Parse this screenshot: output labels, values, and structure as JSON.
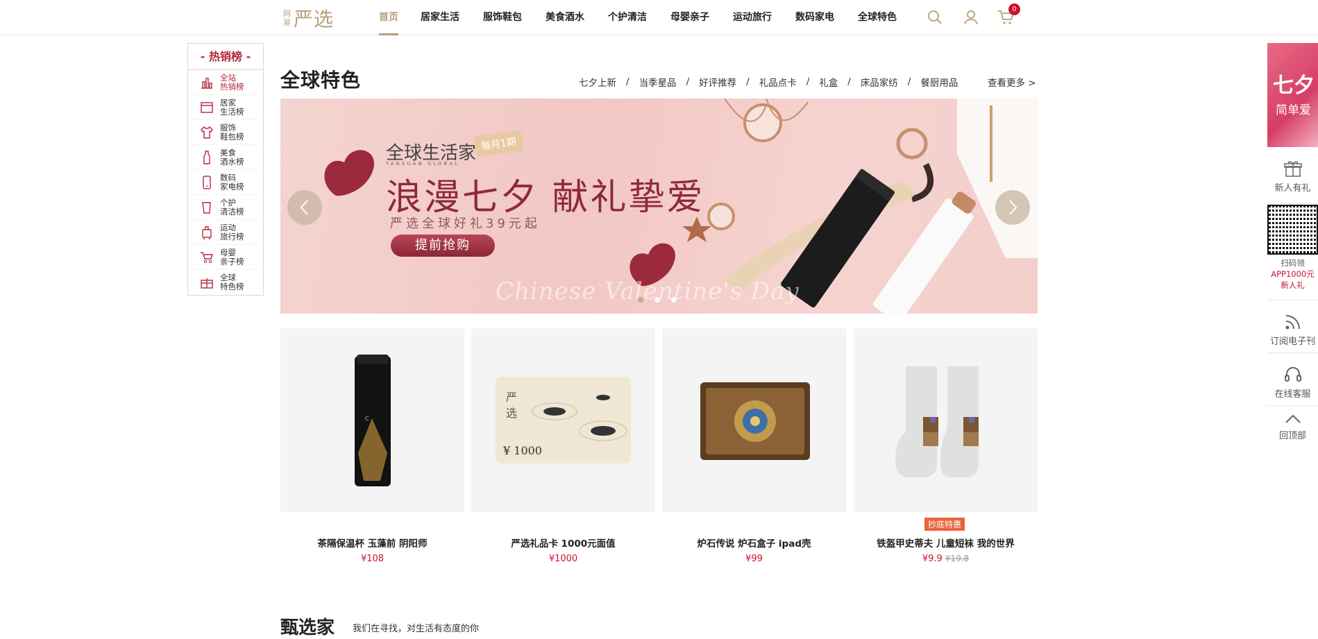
{
  "header": {
    "logo_small_1": "网",
    "logo_small_2": "易",
    "logo_big": "严选",
    "nav": [
      "首页",
      "居家生活",
      "服饰鞋包",
      "美食酒水",
      "个护清洁",
      "母婴亲子",
      "运动旅行",
      "数码家电",
      "全球特色"
    ],
    "active_nav": "首页",
    "cart_count": "0"
  },
  "hot": {
    "title": "- 热销榜 -",
    "items": [
      {
        "l1": "全站",
        "l2": "热销榜",
        "icon": "bar-chart-icon"
      },
      {
        "l1": "居家",
        "l2": "生活榜",
        "icon": "home-box-icon"
      },
      {
        "l1": "服饰",
        "l2": "鞋包榜",
        "icon": "shirt-icon"
      },
      {
        "l1": "美食",
        "l2": "酒水榜",
        "icon": "bottle-icon"
      },
      {
        "l1": "数码",
        "l2": "家电榜",
        "icon": "phone-icon"
      },
      {
        "l1": "个护",
        "l2": "清洁榜",
        "icon": "cup-icon"
      },
      {
        "l1": "运动",
        "l2": "旅行榜",
        "icon": "luggage-icon"
      },
      {
        "l1": "母婴",
        "l2": "亲子榜",
        "icon": "stroller-icon"
      },
      {
        "l1": "全球",
        "l2": "特色榜",
        "icon": "gift-icon"
      }
    ]
  },
  "section": {
    "title": "全球特色",
    "links": [
      "七夕上新",
      "当季星品",
      "好评推荐",
      "礼品点卡",
      "礼盒",
      "床品家纺",
      "餐厨用品"
    ],
    "more": "查看更多 >"
  },
  "banner": {
    "brand": "全球生活家",
    "brand_sub": "YANXUAN GLOBAL",
    "badge": "每月1期",
    "headline": "浪漫七夕 献礼挚爱",
    "tagline": "严选全球好礼39元起",
    "button": "提前抢购",
    "script": "Chinese Valentine's Day"
  },
  "products": [
    {
      "name": "茶隔保温杯 玉藻前 阴阳师",
      "price": "¥108",
      "old": ""
    },
    {
      "name": "严选礼品卡 1000元面值",
      "price": "¥1000",
      "old": "",
      "card_text": "¥ 1000"
    },
    {
      "name": "炉石传说 炉石盒子 ipad壳",
      "price": "¥99",
      "old": ""
    },
    {
      "name": "铁盔甲史蒂夫 儿童短袜 我的世界",
      "price": "¥9.9",
      "old": "¥19.8"
    }
  ],
  "promo_tag": "抄底特惠",
  "section2": {
    "title": "甄选家",
    "subtitle": "我们在寻找，对生活有态度的你"
  },
  "rail": {
    "promo_big": "七夕",
    "promo_small": "简单爱",
    "gift": "新人有礼",
    "qr_t1": "扫码领",
    "qr_t2": "APP1000元",
    "qr_t3": "新人礼",
    "subscribe": "订阅电子刊",
    "service": "在线客服",
    "top": "回顶部"
  },
  "colors": {
    "accent": "#b4a078",
    "brand_red": "#b4283c",
    "price_red": "#d0102f",
    "promo": "#e9643c"
  }
}
